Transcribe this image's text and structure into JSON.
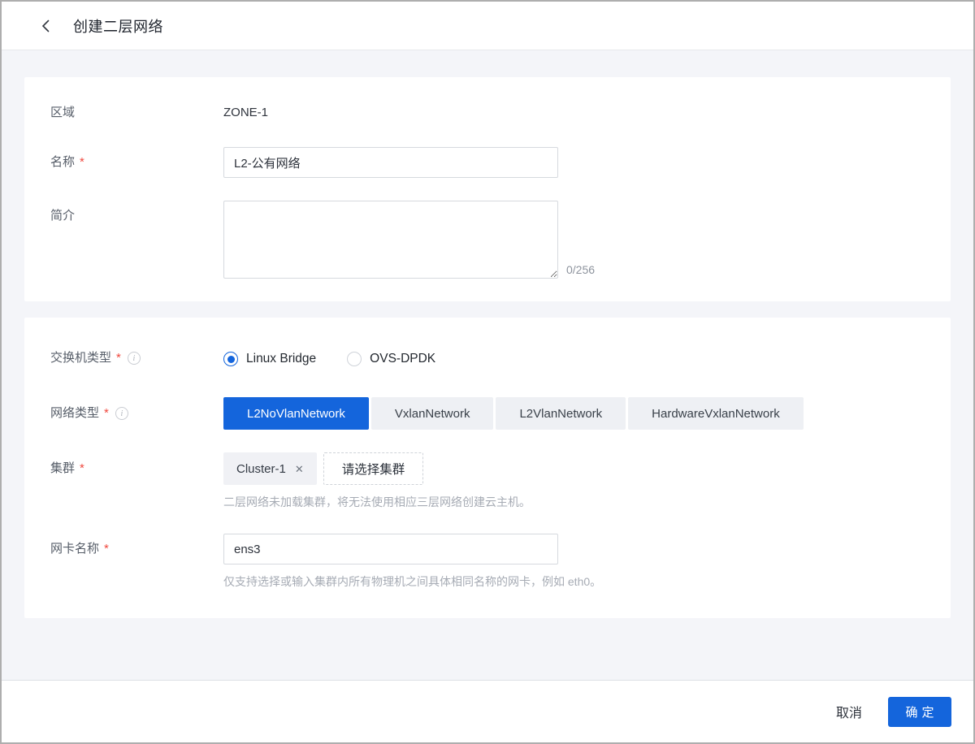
{
  "colors": {
    "accent": "#1465dc",
    "required_mark": "#f0483e",
    "page_bg": "#f4f5f9",
    "segment_bg": "#eef0f4",
    "tag_bg": "#f0f1f5"
  },
  "icons": {
    "back": "‹",
    "info": "i",
    "close": "✕"
  },
  "misc": {
    "required_mark": "*"
  },
  "header": {
    "title": "创建二层网络"
  },
  "basic": {
    "zone_label": "区域",
    "zone_value": "ZONE-1",
    "name_label": "名称",
    "name_value": "L2-公有网络",
    "desc_label": "简介",
    "desc_value": "",
    "desc_counter": "0/256"
  },
  "network": {
    "switch_label": "交换机类型",
    "switch_options": [
      {
        "label": "Linux Bridge",
        "selected": true
      },
      {
        "label": "OVS-DPDK",
        "selected": false
      }
    ],
    "type_label": "网络类型",
    "type_options": [
      {
        "label": "L2NoVlanNetwork",
        "selected": true
      },
      {
        "label": "VxlanNetwork",
        "selected": false
      },
      {
        "label": "L2VlanNetwork",
        "selected": false
      },
      {
        "label": "HardwareVxlanNetwork",
        "selected": false
      }
    ],
    "cluster_label": "集群",
    "cluster_tag": "Cluster-1",
    "cluster_select_button": "请选择集群",
    "cluster_help": "二层网络未加载集群，将无法使用相应三层网络创建云主机。",
    "nic_label": "网卡名称",
    "nic_value": "ens3",
    "nic_help": "仅支持选择或输入集群内所有物理机之间具体相同名称的网卡，例如 eth0。"
  },
  "footer": {
    "cancel": "取消",
    "ok": "确定"
  }
}
